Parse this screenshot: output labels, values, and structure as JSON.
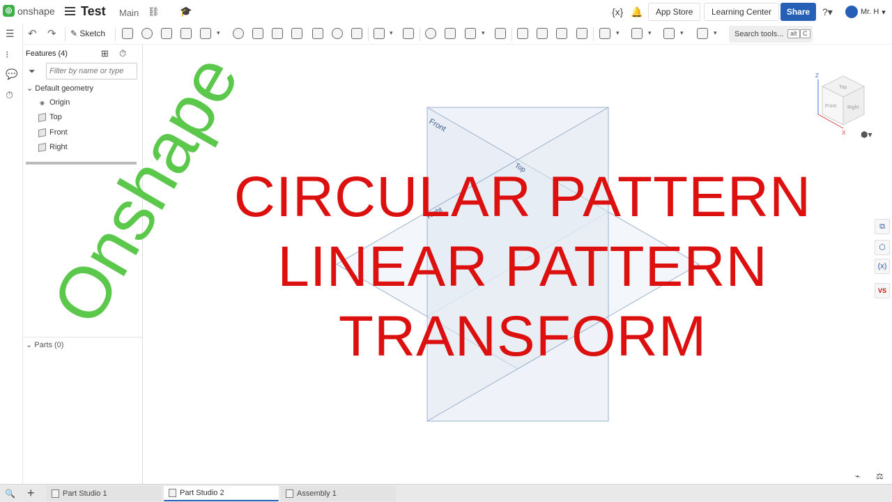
{
  "header": {
    "logo_text": "onshape",
    "doc_title": "Test",
    "branch": "Main",
    "app_store": "App Store",
    "learning_center": "Learning Center",
    "share": "Share",
    "user": "Mr. H",
    "variables_icon": "{x}"
  },
  "toolbar": {
    "sketch_label": "Sketch",
    "search_tools": "Search tools...",
    "search_shortcut_1": "alt",
    "search_shortcut_2": "C"
  },
  "feature_panel": {
    "title": "Features (4)",
    "filter_placeholder": "Filter by name or type",
    "default_geometry": "Default geometry",
    "items": [
      {
        "label": "Origin",
        "icon": "origin-icon"
      },
      {
        "label": "Top",
        "icon": "plane-icon"
      },
      {
        "label": "Front",
        "icon": "plane-icon"
      },
      {
        "label": "Right",
        "icon": "plane-icon"
      }
    ],
    "parts": "Parts (0)"
  },
  "viewport": {
    "plane_labels": {
      "front": "Front",
      "top": "Top",
      "right": "Right"
    },
    "viewcube": {
      "top": "Top",
      "front": "Front",
      "right": "Right",
      "x": "X",
      "z": "Z"
    }
  },
  "overlay": {
    "line1": "CIRCULAR PATTERN",
    "line2": "LINEAR PATTERN",
    "line3": "TRANSFORM",
    "brand": "Onshape",
    "headline_color": "#dd1010",
    "brand_color": "#5bc84c"
  },
  "tabs": [
    {
      "label": "Part Studio 1",
      "active": false
    },
    {
      "label": "Part Studio 2",
      "active": true
    },
    {
      "label": "Assembly 1",
      "active": false
    }
  ],
  "colors": {
    "accent": "#2660b6",
    "onshape_green": "#3eb04a"
  }
}
